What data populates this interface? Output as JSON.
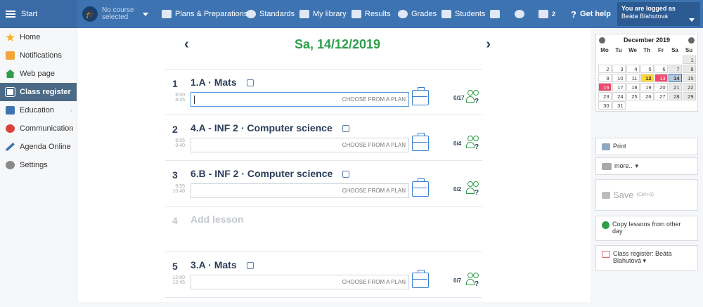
{
  "topbar": {
    "start_label": "Start",
    "course_label": "No course selected",
    "nav": [
      {
        "label": "Plans & Preparations",
        "icon": "briefcase-icon"
      },
      {
        "label": "Standards",
        "icon": "shield-icon"
      },
      {
        "label": "My library",
        "icon": "library-icon"
      },
      {
        "label": "Results",
        "icon": "bar-chart-icon"
      },
      {
        "label": "Grades",
        "icon": "grades-icon"
      },
      {
        "label": "Students",
        "icon": "students-icon"
      }
    ],
    "messages_count": "2",
    "help_label": "Get help",
    "logged_as_label": "You are logged as",
    "user_name": "Beáta Blahutová"
  },
  "sidebar": {
    "items": [
      {
        "label": "Home",
        "icon": "star-icon",
        "color": "#f5b324"
      },
      {
        "label": "Notifications",
        "icon": "envelope-icon",
        "color": "#f3a43a"
      },
      {
        "label": "Web page",
        "icon": "house-icon",
        "color": "#2e9e4b"
      },
      {
        "label": "Class register",
        "icon": "register-icon",
        "color": "#ffffff"
      },
      {
        "label": "Education",
        "icon": "education-icon",
        "color": "#3e73b1"
      },
      {
        "label": "Communication",
        "icon": "chat-icon",
        "color": "#d9443a"
      },
      {
        "label": "Agenda Online",
        "icon": "pen-icon",
        "color": "#3e73b1"
      },
      {
        "label": "Settings",
        "icon": "gear-icon",
        "color": "#8a8a8a"
      }
    ]
  },
  "main": {
    "date_title": "Sa, 14/12/2019",
    "choose_label": "CHOOSE FROM A PLAN",
    "add_lesson_number": "4",
    "add_lesson_label": "Add lesson",
    "lessons": [
      {
        "number": "1",
        "name": "1.A · Mats",
        "time_start": "8:00",
        "time_end": "8:45",
        "attendance": "0/17"
      },
      {
        "number": "2",
        "name": "4.A - INF 2 · Computer science",
        "time_start": "8:55",
        "time_end": "9:40",
        "attendance": "0/4"
      },
      {
        "number": "3",
        "name": "6.B - INF 2 · Computer science",
        "time_start": "9:55",
        "time_end": "10:40",
        "attendance": "0/2"
      },
      {
        "number": "5",
        "name": "3.A · Mats",
        "time_start": "12:00",
        "time_end": "12:45",
        "attendance": "0/7"
      }
    ]
  },
  "calendar": {
    "month": "December 2019",
    "days_of_week": [
      "Mo",
      "Tu",
      "We",
      "Th",
      "Fr",
      "Sa",
      "Su"
    ],
    "weeks": [
      [
        "",
        "",
        "",
        "",
        "",
        "",
        "1"
      ],
      [
        "2",
        "3",
        "4",
        "5",
        "6",
        "7",
        "8"
      ],
      [
        "9",
        "10",
        "11",
        "12",
        "13",
        "14",
        "15"
      ],
      [
        "16",
        "17",
        "18",
        "19",
        "20",
        "21",
        "22"
      ],
      [
        "23",
        "24",
        "25",
        "26",
        "27",
        "28",
        "29"
      ],
      [
        "30",
        "31",
        "",
        "",
        "",
        "",
        ""
      ]
    ],
    "today": "12",
    "selected": "14",
    "holidays": [
      "13",
      "16"
    ],
    "colors": {
      "holiday": "#f04a6e",
      "today": "#ffd93b",
      "selected": "#b8c9dc"
    }
  },
  "actions": {
    "print_label": "Print",
    "more_label": "more..",
    "save_label": "Save",
    "save_shortcut": "(Ctrl+S)",
    "copy_label": "Copy lessons from other day",
    "register_label": "Class register: Beáta Blahutová"
  },
  "colors": {
    "topbar": "#3e73b1",
    "accent_green": "#2e9e4b",
    "active_sidebar": "#4a6a86"
  }
}
